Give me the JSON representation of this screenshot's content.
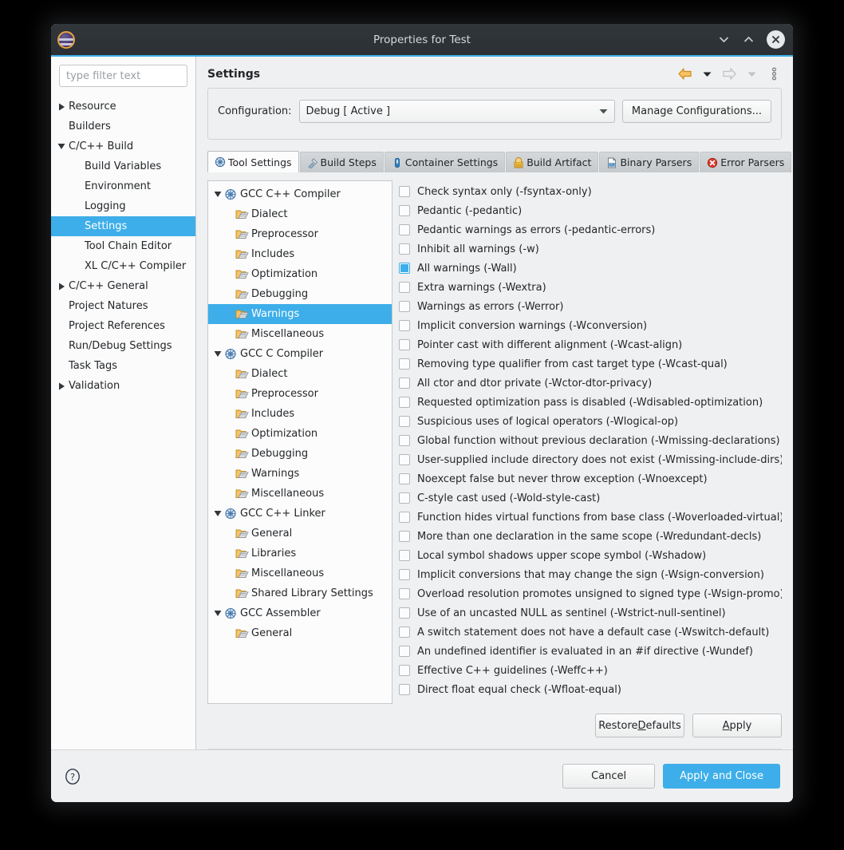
{
  "window": {
    "title": "Properties for Test",
    "icon": "eclipse-icon",
    "controls": {
      "minimize": "minimize-icon",
      "maximize": "maximize-icon",
      "close": "close-icon"
    }
  },
  "colors": {
    "accent": "#3daee9",
    "titlebar": "#31363b",
    "surface": "#eff0f1",
    "text": "#232629"
  },
  "sidebar": {
    "filter": {
      "placeholder": "type filter text",
      "value": ""
    },
    "items": [
      {
        "label": "Resource",
        "indent": 1,
        "arrow": "collapsed",
        "selected": false
      },
      {
        "label": "Builders",
        "indent": 1,
        "arrow": "none",
        "selected": false
      },
      {
        "label": "C/C++ Build",
        "indent": 1,
        "arrow": "expanded",
        "selected": false
      },
      {
        "label": "Build Variables",
        "indent": 2,
        "arrow": "none",
        "selected": false
      },
      {
        "label": "Environment",
        "indent": 2,
        "arrow": "none",
        "selected": false
      },
      {
        "label": "Logging",
        "indent": 2,
        "arrow": "none",
        "selected": false
      },
      {
        "label": "Settings",
        "indent": 2,
        "arrow": "none",
        "selected": true
      },
      {
        "label": "Tool Chain Editor",
        "indent": 2,
        "arrow": "none",
        "selected": false
      },
      {
        "label": "XL C/C++ Compiler",
        "indent": 2,
        "arrow": "none",
        "selected": false
      },
      {
        "label": "C/C++ General",
        "indent": 1,
        "arrow": "collapsed",
        "selected": false
      },
      {
        "label": "Project Natures",
        "indent": 1,
        "arrow": "none",
        "selected": false
      },
      {
        "label": "Project References",
        "indent": 1,
        "arrow": "none",
        "selected": false
      },
      {
        "label": "Run/Debug Settings",
        "indent": 1,
        "arrow": "none",
        "selected": false
      },
      {
        "label": "Task Tags",
        "indent": 1,
        "arrow": "none",
        "selected": false
      },
      {
        "label": "Validation",
        "indent": 1,
        "arrow": "collapsed",
        "selected": false
      }
    ]
  },
  "page": {
    "title": "Settings",
    "toolbar": [
      {
        "name": "back-arrow-icon",
        "enabled": true
      },
      {
        "name": "back-dropdown-icon",
        "enabled": true
      },
      {
        "name": "forward-arrow-icon",
        "enabled": false
      },
      {
        "name": "forward-dropdown-icon",
        "enabled": false
      },
      {
        "name": "view-menu-icon",
        "enabled": true
      }
    ]
  },
  "configuration": {
    "label": "Configuration:",
    "selected": "Debug  [ Active ]",
    "manage_button": "Manage Configurations..."
  },
  "tabs": [
    {
      "label": "Tool Settings",
      "icon": "tool-settings-icon",
      "active": true
    },
    {
      "label": "Build Steps",
      "icon": "build-steps-icon",
      "active": false
    },
    {
      "label": "Container Settings",
      "icon": "container-settings-icon",
      "active": false
    },
    {
      "label": "Build Artifact",
      "icon": "build-artifact-icon",
      "active": false
    },
    {
      "label": "Binary Parsers",
      "icon": "binary-parsers-icon",
      "active": false
    },
    {
      "label": "Error Parsers",
      "icon": "error-parsers-icon",
      "active": false
    }
  ],
  "tool_tree": [
    {
      "label": "GCC C++ Compiler",
      "indent": 0,
      "arrow": "expanded",
      "icon": "tool-icon",
      "selected": false
    },
    {
      "label": "Dialect",
      "indent": 1,
      "arrow": "none",
      "icon": "folder-icon",
      "selected": false
    },
    {
      "label": "Preprocessor",
      "indent": 1,
      "arrow": "none",
      "icon": "folder-icon",
      "selected": false
    },
    {
      "label": "Includes",
      "indent": 1,
      "arrow": "none",
      "icon": "folder-icon",
      "selected": false
    },
    {
      "label": "Optimization",
      "indent": 1,
      "arrow": "none",
      "icon": "folder-icon",
      "selected": false
    },
    {
      "label": "Debugging",
      "indent": 1,
      "arrow": "none",
      "icon": "folder-icon",
      "selected": false
    },
    {
      "label": "Warnings",
      "indent": 1,
      "arrow": "none",
      "icon": "folder-icon",
      "selected": true
    },
    {
      "label": "Miscellaneous",
      "indent": 1,
      "arrow": "none",
      "icon": "folder-icon",
      "selected": false
    },
    {
      "label": "GCC C Compiler",
      "indent": 0,
      "arrow": "expanded",
      "icon": "tool-icon",
      "selected": false
    },
    {
      "label": "Dialect",
      "indent": 1,
      "arrow": "none",
      "icon": "folder-icon",
      "selected": false
    },
    {
      "label": "Preprocessor",
      "indent": 1,
      "arrow": "none",
      "icon": "folder-icon",
      "selected": false
    },
    {
      "label": "Includes",
      "indent": 1,
      "arrow": "none",
      "icon": "folder-icon",
      "selected": false
    },
    {
      "label": "Optimization",
      "indent": 1,
      "arrow": "none",
      "icon": "folder-icon",
      "selected": false
    },
    {
      "label": "Debugging",
      "indent": 1,
      "arrow": "none",
      "icon": "folder-icon",
      "selected": false
    },
    {
      "label": "Warnings",
      "indent": 1,
      "arrow": "none",
      "icon": "folder-icon",
      "selected": false
    },
    {
      "label": "Miscellaneous",
      "indent": 1,
      "arrow": "none",
      "icon": "folder-icon",
      "selected": false
    },
    {
      "label": "GCC C++ Linker",
      "indent": 0,
      "arrow": "expanded",
      "icon": "tool-icon",
      "selected": false
    },
    {
      "label": "General",
      "indent": 1,
      "arrow": "none",
      "icon": "folder-icon",
      "selected": false
    },
    {
      "label": "Libraries",
      "indent": 1,
      "arrow": "none",
      "icon": "folder-icon",
      "selected": false
    },
    {
      "label": "Miscellaneous",
      "indent": 1,
      "arrow": "none",
      "icon": "folder-icon",
      "selected": false
    },
    {
      "label": "Shared Library Settings",
      "indent": 1,
      "arrow": "none",
      "icon": "folder-icon",
      "selected": false
    },
    {
      "label": "GCC Assembler",
      "indent": 0,
      "arrow": "expanded",
      "icon": "tool-icon",
      "selected": false
    },
    {
      "label": "General",
      "indent": 1,
      "arrow": "none",
      "icon": "folder-icon",
      "selected": false
    }
  ],
  "options": [
    {
      "label": "Check syntax only (-fsyntax-only)",
      "checked": false
    },
    {
      "label": "Pedantic (-pedantic)",
      "checked": false
    },
    {
      "label": "Pedantic warnings as errors (-pedantic-errors)",
      "checked": false
    },
    {
      "label": "Inhibit all warnings (-w)",
      "checked": false
    },
    {
      "label": "All warnings (-Wall)",
      "checked": true
    },
    {
      "label": "Extra warnings (-Wextra)",
      "checked": false
    },
    {
      "label": "Warnings as errors (-Werror)",
      "checked": false
    },
    {
      "label": "Implicit conversion warnings (-Wconversion)",
      "checked": false
    },
    {
      "label": "Pointer cast with different alignment (-Wcast-align)",
      "checked": false
    },
    {
      "label": "Removing type qualifier from cast target type (-Wcast-qual)",
      "checked": false
    },
    {
      "label": "All ctor and dtor private (-Wctor-dtor-privacy)",
      "checked": false
    },
    {
      "label": "Requested optimization pass is disabled (-Wdisabled-optimization)",
      "checked": false
    },
    {
      "label": "Suspicious uses of logical operators (-Wlogical-op)",
      "checked": false
    },
    {
      "label": "Global function without previous declaration (-Wmissing-declarations)",
      "checked": false
    },
    {
      "label": "User-supplied include directory does not exist (-Wmissing-include-dirs)",
      "checked": false
    },
    {
      "label": "Noexcept false but never throw exception (-Wnoexcept)",
      "checked": false
    },
    {
      "label": "C-style cast used (-Wold-style-cast)",
      "checked": false
    },
    {
      "label": "Function hides virtual functions from base class (-Woverloaded-virtual)",
      "checked": false
    },
    {
      "label": "More than one declaration in the same scope (-Wredundant-decls)",
      "checked": false
    },
    {
      "label": "Local symbol shadows upper scope symbol (-Wshadow)",
      "checked": false
    },
    {
      "label": "Implicit conversions that may change the sign (-Wsign-conversion)",
      "checked": false
    },
    {
      "label": "Overload resolution promotes unsigned to signed type (-Wsign-promo)",
      "checked": false
    },
    {
      "label": "Use of an uncasted NULL as sentinel (-Wstrict-null-sentinel)",
      "checked": false
    },
    {
      "label": "A switch statement does not have a default case (-Wswitch-default)",
      "checked": false
    },
    {
      "label": "An undefined identifier is evaluated in an #if directive (-Wundef)",
      "checked": false
    },
    {
      "label": "Effective C++ guidelines (-Weffc++)",
      "checked": false
    },
    {
      "label": "Direct float equal check (-Wfloat-equal)",
      "checked": false
    }
  ],
  "page_buttons": {
    "restore_defaults": {
      "pre": "Restore ",
      "mnemonic": "D",
      "post": "efaults"
    },
    "apply": {
      "pre": "",
      "mnemonic": "A",
      "post": "pply"
    }
  },
  "footer": {
    "help_icon": "help-icon",
    "cancel": "Cancel",
    "apply_and_close": "Apply and Close"
  }
}
